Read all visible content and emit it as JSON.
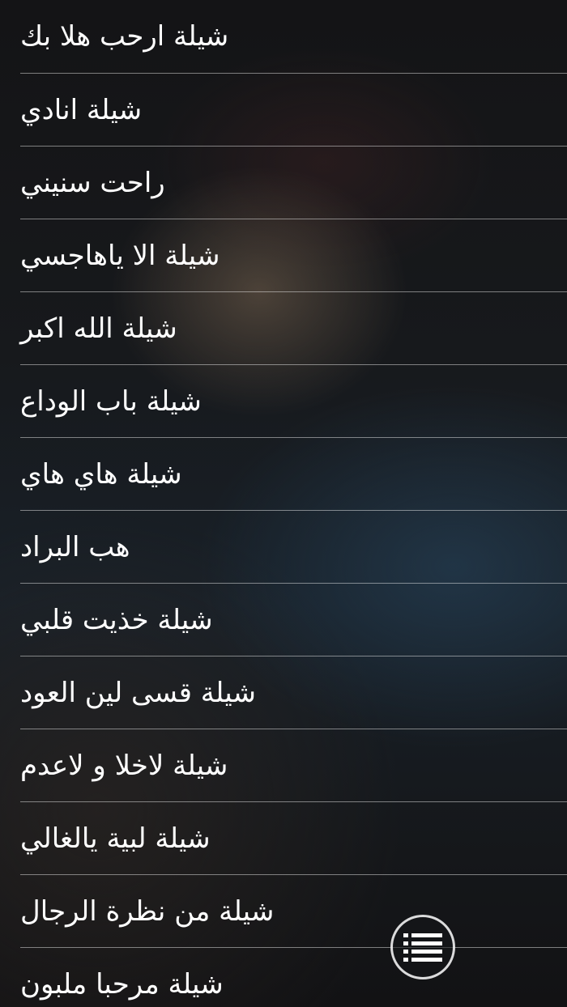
{
  "list": {
    "items": [
      {
        "label": "شيلة ارحب هلا بك"
      },
      {
        "label": "شيلة انادي"
      },
      {
        "label": "راحت سنيني"
      },
      {
        "label": "شيلة الا ياهاجسي"
      },
      {
        "label": "شيلة الله اكبر"
      },
      {
        "label": "شيلة باب الوداع"
      },
      {
        "label": "شيلة هاي هاي"
      },
      {
        "label": "هب البراد"
      },
      {
        "label": "شيلة خذيت قلبي"
      },
      {
        "label": "شيلة قسى لين العود"
      },
      {
        "label": "شيلة لاخلا و لاعدم"
      },
      {
        "label": "شيلة لبية يالغالي"
      },
      {
        "label": "شيلة من نظرة الرجال"
      },
      {
        "label": "شيلة مرحبا ملبون"
      }
    ]
  },
  "menu_button": {
    "icon": "list-menu-icon"
  }
}
